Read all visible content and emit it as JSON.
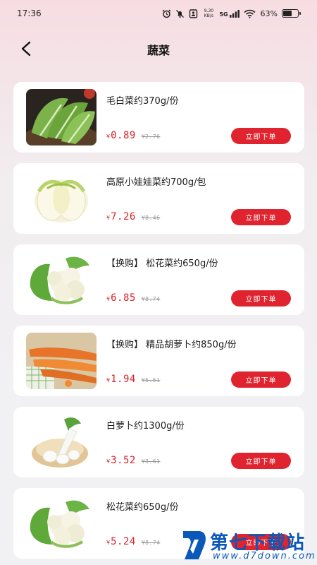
{
  "status_bar": {
    "time": "17:36",
    "net_speed_value": "9.30",
    "net_speed_unit": "KB/s",
    "network": "5G",
    "battery": "63%",
    "battery_level": 0.63
  },
  "header": {
    "title": "蔬菜",
    "back_icon": "chevron-left-icon"
  },
  "products": [
    {
      "name": "毛白菜约370g/份",
      "currency": "¥",
      "price": "0.89",
      "old_price": "¥2.76",
      "button": "立即下单",
      "image": "napa-cabbage-green"
    },
    {
      "name": "高原小娃娃菜约700g/包",
      "currency": "¥",
      "price": "7.26",
      "old_price": "¥8.46",
      "button": "立即下单",
      "image": "baby-cabbage"
    },
    {
      "name": "【换购】 松花菜约650g/份",
      "currency": "¥",
      "price": "6.85",
      "old_price": "¥8.74",
      "button": "立即下单",
      "image": "cauliflower"
    },
    {
      "name": "【换购】 精品胡萝卜约850g/份",
      "currency": "¥",
      "price": "1.94",
      "old_price": "¥5.51",
      "button": "立即下单",
      "image": "carrots"
    },
    {
      "name": "白萝卜约1300g/份",
      "currency": "¥",
      "price": "3.52",
      "old_price": "¥3.61",
      "button": "立即下单",
      "image": "white-radish"
    },
    {
      "name": "松花菜约650g/份",
      "currency": "¥",
      "price": "5.24",
      "old_price": "¥8.74",
      "button": "立即下单",
      "image": "cauliflower"
    }
  ],
  "watermark": {
    "text": "第七下载站",
    "url": "www.d7down.com"
  },
  "colors": {
    "accent": "#e0242f",
    "price": "#d8232a",
    "watermark": "#0a58b8"
  }
}
